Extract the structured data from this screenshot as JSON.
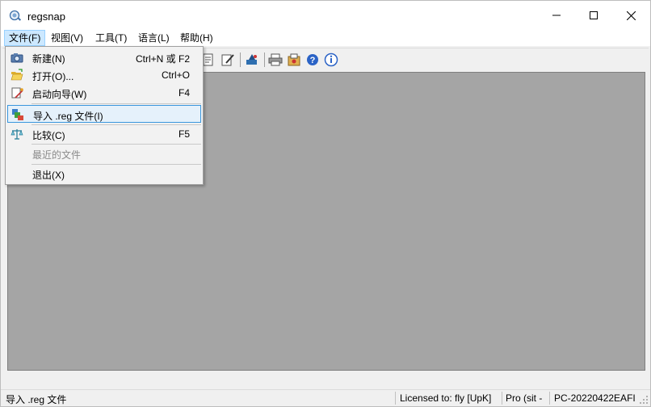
{
  "window": {
    "title": "regsnap"
  },
  "menubar": {
    "items": [
      {
        "label": "文件(F)"
      },
      {
        "label": "视图(V)"
      },
      {
        "label": "工具(T)"
      },
      {
        "label": "语言(L)"
      },
      {
        "label": "帮助(H)"
      }
    ]
  },
  "file_menu": {
    "items": [
      {
        "label": "新建(N)",
        "shortcut": "Ctrl+N 或 F2",
        "icon": "camera-icon"
      },
      {
        "label": "打开(O)...",
        "shortcut": "Ctrl+O",
        "icon": "folder-open-icon"
      },
      {
        "label": "启动向导(W)",
        "shortcut": "F4",
        "icon": "wizard-icon"
      },
      {
        "label": "导入 .reg 文件(I)",
        "shortcut": "",
        "icon": "import-reg-icon"
      },
      {
        "label": "比较(C)",
        "shortcut": "F5",
        "icon": "scales-icon"
      },
      {
        "label": "最近的文件",
        "shortcut": ""
      },
      {
        "label": "退出(X)",
        "shortcut": ""
      }
    ]
  },
  "toolbar": {
    "icons": [
      "report-icon",
      "edit-icon",
      "tools-icon",
      "print-icon",
      "settings-icon",
      "help-icon",
      "info-icon"
    ]
  },
  "statusbar": {
    "message": "导入 .reg 文件",
    "license": "Licensed to: fly [UpK]",
    "edition": "Pro (sit -",
    "computer": "PC-20220422EAFI"
  },
  "colors": {
    "client_bg": "#a5a5a5",
    "menu_highlight": "#cce8ff",
    "item_highlight_border": "#3a96dd"
  }
}
